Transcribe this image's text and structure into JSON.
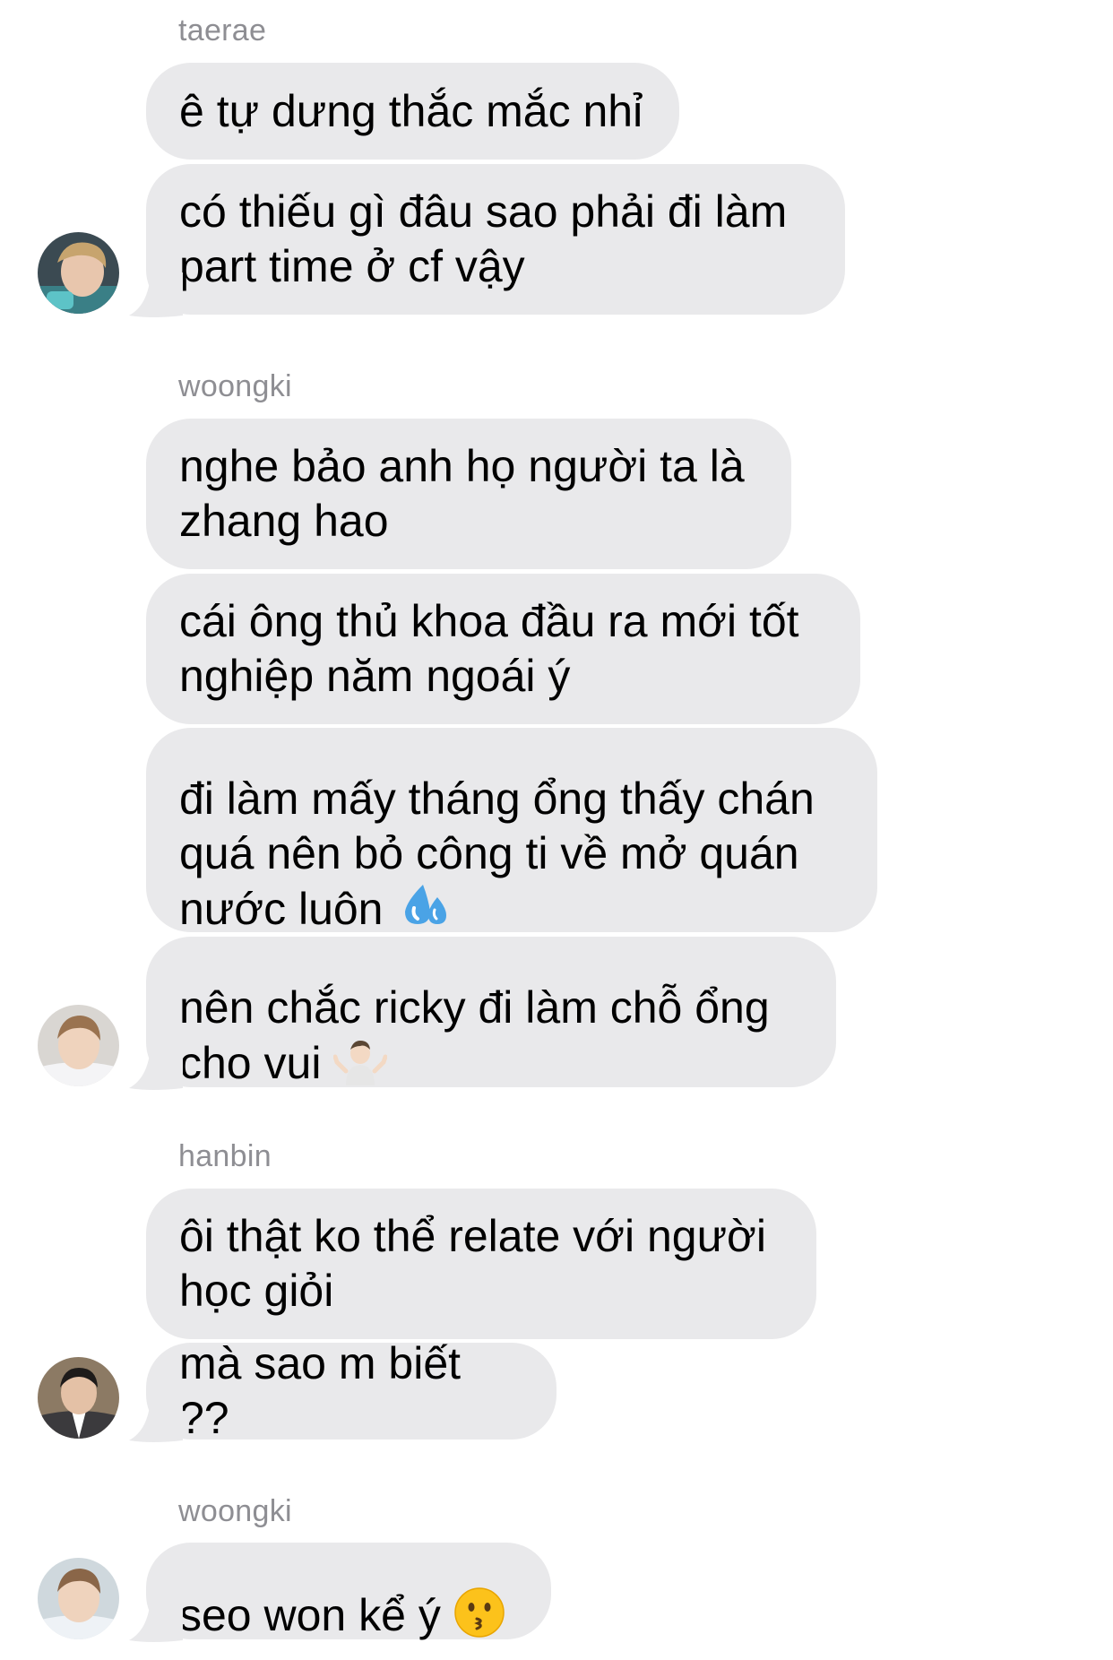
{
  "groups": [
    {
      "sender": "taerae",
      "messages": [
        "ê tự dưng thắc mắc nhỉ",
        "có thiếu gì đâu sao phải đi làm\npart time ở cf vậy"
      ]
    },
    {
      "sender": "woongki",
      "messages": [
        "nghe bảo anh họ người ta là\nzhang hao",
        "cái ông thủ khoa đầu ra mới tốt\nnghiệp năm ngoái ý",
        "đi làm mấy tháng ổng thấy chán\nquá nên bỏ công ti về mở quán\nnước luôn",
        "nên chắc ricky đi làm chỗ ổng\ncho vui"
      ]
    },
    {
      "sender": "hanbin",
      "messages": [
        "ôi thật ko thể relate với người\nhọc giỏi",
        "mà sao m biết ??"
      ]
    },
    {
      "sender": "woongki",
      "messages": [
        "seo won kể ý"
      ]
    }
  ],
  "emojis": {
    "sweat_droplets": "sweat-droplets-icon",
    "shrug": "person-shrugging-icon",
    "kiss_face": "kissing-face-icon"
  },
  "colors": {
    "bubble": "#e9e9eb",
    "sender": "#8e8e93"
  }
}
